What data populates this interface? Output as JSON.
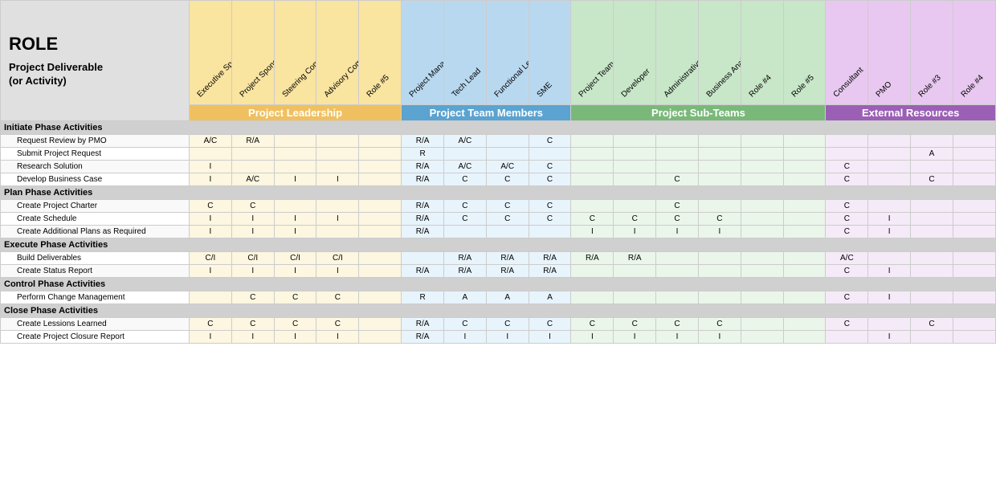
{
  "title": "ROLE",
  "deliverable_label": "Project Deliverable\n(or Activity)",
  "groups": [
    {
      "label": "Project Leadership",
      "color": "leadership",
      "span": 5
    },
    {
      "label": "Project Team Members",
      "color": "team",
      "span": 4
    },
    {
      "label": "Project Sub-Teams",
      "color": "subteams",
      "span": 6
    },
    {
      "label": "External Resources",
      "color": "external",
      "span": 4
    }
  ],
  "columns": [
    {
      "label": "Executive Sponsor",
      "group": "leadership"
    },
    {
      "label": "Project Sponsor",
      "group": "leadership"
    },
    {
      "label": "Steering Committee",
      "group": "leadership"
    },
    {
      "label": "Advisory Committee",
      "group": "leadership"
    },
    {
      "label": "Role #5",
      "group": "leadership"
    },
    {
      "label": "Project Manager",
      "group": "team"
    },
    {
      "label": "Tech Lead",
      "group": "team"
    },
    {
      "label": "Functional Lead",
      "group": "team"
    },
    {
      "label": "SME",
      "group": "team"
    },
    {
      "label": "Project Team Member",
      "group": "subteams"
    },
    {
      "label": "Developer",
      "group": "subteams"
    },
    {
      "label": "Administrative Support",
      "group": "subteams"
    },
    {
      "label": "Business Analyst",
      "group": "subteams"
    },
    {
      "label": "Role #4",
      "group": "subteams"
    },
    {
      "label": "Role #5",
      "group": "subteams"
    },
    {
      "label": "Consultant",
      "group": "external"
    },
    {
      "label": "PMO",
      "group": "external"
    },
    {
      "label": "Role #3",
      "group": "external"
    },
    {
      "label": "Role #4",
      "group": "external"
    }
  ],
  "phases": [
    {
      "label": "Initiate Phase Activities",
      "activities": [
        {
          "name": "Request Review by PMO",
          "values": [
            "A/C",
            "R/A",
            "",
            "",
            "",
            "R/A",
            "A/C",
            "",
            "C",
            "",
            "",
            "",
            "",
            "",
            "",
            "",
            "",
            "",
            ""
          ]
        },
        {
          "name": "Submit Project Request",
          "values": [
            "",
            "",
            "",
            "",
            "",
            "R",
            "",
            "",
            "",
            "",
            "",
            "",
            "",
            "",
            "",
            "",
            "",
            "A",
            ""
          ]
        },
        {
          "name": "Research Solution",
          "values": [
            "I",
            "",
            "",
            "",
            "",
            "R/A",
            "A/C",
            "A/C",
            "C",
            "",
            "",
            "",
            "",
            "",
            "",
            "C",
            "",
            "",
            ""
          ]
        },
        {
          "name": "Develop Business Case",
          "values": [
            "I",
            "A/C",
            "I",
            "I",
            "",
            "R/A",
            "C",
            "C",
            "C",
            "",
            "",
            "C",
            "",
            "",
            "",
            "C",
            "",
            "C",
            ""
          ]
        }
      ]
    },
    {
      "label": "Plan Phase Activities",
      "activities": [
        {
          "name": "Create Project Charter",
          "values": [
            "C",
            "C",
            "",
            "",
            "",
            "R/A",
            "C",
            "C",
            "C",
            "",
            "",
            "C",
            "",
            "",
            "",
            "C",
            "",
            "",
            ""
          ]
        },
        {
          "name": "Create Schedule",
          "values": [
            "I",
            "I",
            "I",
            "I",
            "",
            "R/A",
            "C",
            "C",
            "C",
            "C",
            "C",
            "C",
            "C",
            "",
            "",
            "C",
            "I",
            "",
            ""
          ]
        },
        {
          "name": "Create Additional Plans as Required",
          "values": [
            "I",
            "I",
            "I",
            "",
            "",
            "R/A",
            "",
            "",
            "",
            "I",
            "I",
            "I",
            "I",
            "",
            "",
            "C",
            "I",
            "",
            ""
          ]
        }
      ]
    },
    {
      "label": "Execute Phase Activities",
      "activities": [
        {
          "name": "Build Deliverables",
          "values": [
            "C/I",
            "C/I",
            "C/I",
            "C/I",
            "",
            "",
            "R/A",
            "R/A",
            "R/A",
            "R/A",
            "R/A",
            "",
            "",
            "",
            "",
            "A/C",
            "",
            "",
            ""
          ]
        },
        {
          "name": "Create Status Report",
          "values": [
            "I",
            "I",
            "I",
            "I",
            "",
            "R/A",
            "R/A",
            "R/A",
            "R/A",
            "",
            "",
            "",
            "",
            "",
            "",
            "C",
            "I",
            "",
            ""
          ]
        }
      ]
    },
    {
      "label": "Control Phase Activities",
      "activities": [
        {
          "name": "Perform Change Management",
          "values": [
            "",
            "C",
            "C",
            "C",
            "",
            "R",
            "A",
            "A",
            "A",
            "",
            "",
            "",
            "",
            "",
            "",
            "C",
            "I",
            "",
            ""
          ]
        }
      ]
    },
    {
      "label": "Close Phase Activities",
      "activities": [
        {
          "name": "Create Lessions Learned",
          "values": [
            "C",
            "C",
            "C",
            "C",
            "",
            "R/A",
            "C",
            "C",
            "C",
            "C",
            "C",
            "C",
            "C",
            "",
            "",
            "C",
            "",
            "C",
            ""
          ]
        },
        {
          "name": "Create Project Closure Report",
          "values": [
            "I",
            "I",
            "I",
            "I",
            "",
            "R/A",
            "I",
            "I",
            "I",
            "I",
            "I",
            "I",
            "I",
            "",
            "",
            "",
            "I",
            "",
            ""
          ]
        }
      ]
    }
  ]
}
